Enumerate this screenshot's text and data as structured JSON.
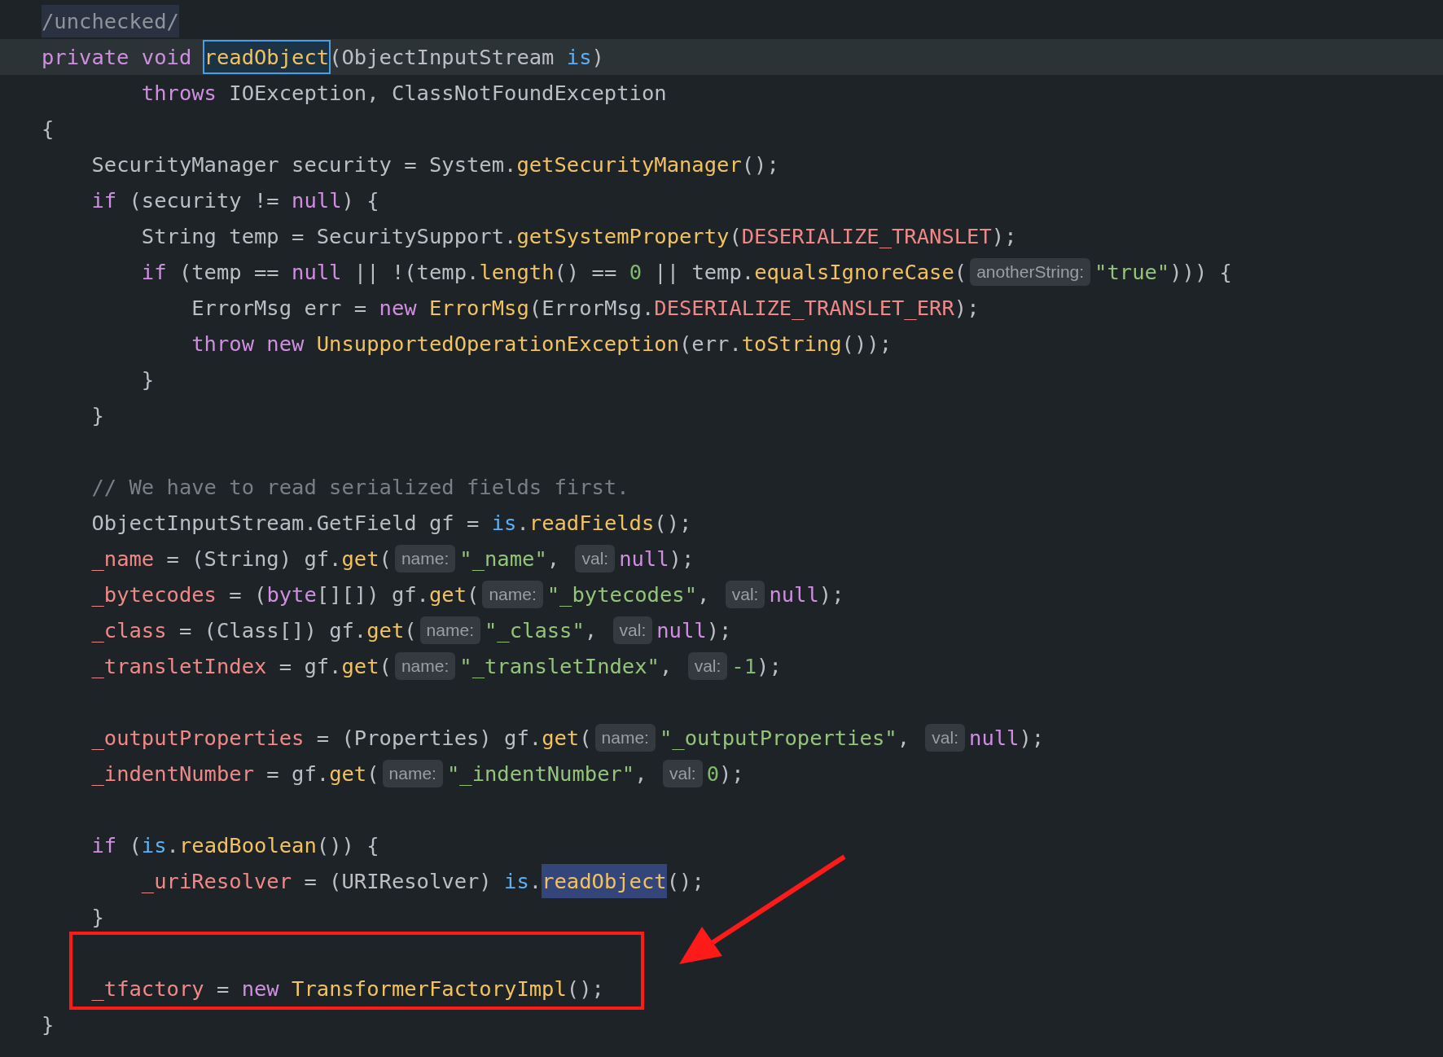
{
  "editor": {
    "lines": [
      {
        "current": false,
        "boxed": false,
        "tokens": [
          {
            "text": "/unchecked/",
            "kind": "folded"
          }
        ]
      },
      {
        "current": true,
        "boxed": false,
        "tokens": [
          {
            "text": "private void ",
            "kind": "keyword"
          },
          {
            "text": "readObject",
            "kind": "method-outlined"
          },
          {
            "text": "(ObjectInputStream ",
            "kind": "plain"
          },
          {
            "text": "is",
            "kind": "param"
          },
          {
            "text": ")",
            "kind": "plain"
          }
        ]
      },
      {
        "current": false,
        "boxed": false,
        "tokens": [
          {
            "text": "        throws ",
            "kind": "keyword"
          },
          {
            "text": "IOException, ClassNotFoundException",
            "kind": "plain"
          }
        ]
      },
      {
        "current": false,
        "boxed": false,
        "tokens": [
          {
            "text": "{",
            "kind": "plain"
          }
        ]
      },
      {
        "current": false,
        "boxed": false,
        "tokens": [
          {
            "text": "    SecurityManager security = System.",
            "kind": "plain"
          },
          {
            "text": "getSecurityManager",
            "kind": "method"
          },
          {
            "text": "();",
            "kind": "plain"
          }
        ]
      },
      {
        "current": false,
        "boxed": false,
        "tokens": [
          {
            "text": "    if ",
            "kind": "keyword"
          },
          {
            "text": "(security != ",
            "kind": "plain"
          },
          {
            "text": "null",
            "kind": "keyword"
          },
          {
            "text": ") {",
            "kind": "plain"
          }
        ]
      },
      {
        "current": false,
        "boxed": false,
        "tokens": [
          {
            "text": "        String temp = SecuritySupport.",
            "kind": "plain"
          },
          {
            "text": "getSystemProperty",
            "kind": "method"
          },
          {
            "text": "(",
            "kind": "plain"
          },
          {
            "text": "DESERIALIZE_TRANSLET",
            "kind": "field"
          },
          {
            "text": ");",
            "kind": "plain"
          }
        ]
      },
      {
        "current": false,
        "boxed": false,
        "tokens": [
          {
            "text": "        if ",
            "kind": "keyword"
          },
          {
            "text": "(temp == ",
            "kind": "plain"
          },
          {
            "text": "null",
            "kind": "keyword"
          },
          {
            "text": " || !(temp.",
            "kind": "plain"
          },
          {
            "text": "length",
            "kind": "method"
          },
          {
            "text": "() == ",
            "kind": "plain"
          },
          {
            "text": "0",
            "kind": "number"
          },
          {
            "text": " || temp.",
            "kind": "plain"
          },
          {
            "text": "equalsIgnoreCase",
            "kind": "method"
          },
          {
            "text": "(",
            "kind": "plain"
          },
          {
            "text": "anotherString:",
            "kind": "hint"
          },
          {
            "text": "\"true\"",
            "kind": "string"
          },
          {
            "text": "))) {",
            "kind": "plain"
          }
        ]
      },
      {
        "current": false,
        "boxed": false,
        "tokens": [
          {
            "text": "            ErrorMsg err = ",
            "kind": "plain"
          },
          {
            "text": "new ",
            "kind": "keyword"
          },
          {
            "text": "ErrorMsg",
            "kind": "method"
          },
          {
            "text": "(ErrorMsg.",
            "kind": "plain"
          },
          {
            "text": "DESERIALIZE_TRANSLET_ERR",
            "kind": "field"
          },
          {
            "text": ");",
            "kind": "plain"
          }
        ]
      },
      {
        "current": false,
        "boxed": false,
        "tokens": [
          {
            "text": "            throw new ",
            "kind": "keyword"
          },
          {
            "text": "UnsupportedOperationException",
            "kind": "method"
          },
          {
            "text": "(err.",
            "kind": "plain"
          },
          {
            "text": "toString",
            "kind": "method"
          },
          {
            "text": "());",
            "kind": "plain"
          }
        ]
      },
      {
        "current": false,
        "boxed": false,
        "tokens": [
          {
            "text": "        }",
            "kind": "plain"
          }
        ]
      },
      {
        "current": false,
        "boxed": false,
        "tokens": [
          {
            "text": "    }",
            "kind": "plain"
          }
        ]
      },
      {
        "current": false,
        "boxed": false
      },
      {
        "current": false,
        "boxed": false,
        "tokens": [
          {
            "text": "    // We have to read serialized fields first.",
            "kind": "comment"
          }
        ]
      },
      {
        "current": false,
        "boxed": false,
        "tokens": [
          {
            "text": "    ObjectInputStream.GetField gf = ",
            "kind": "plain"
          },
          {
            "text": "is",
            "kind": "param"
          },
          {
            "text": ".",
            "kind": "plain"
          },
          {
            "text": "readFields",
            "kind": "method"
          },
          {
            "text": "();",
            "kind": "plain"
          }
        ]
      },
      {
        "current": false,
        "boxed": false,
        "tokens": [
          {
            "text": "    _name",
            "kind": "field"
          },
          {
            "text": " = (String) gf.",
            "kind": "plain"
          },
          {
            "text": "get",
            "kind": "method"
          },
          {
            "text": "(",
            "kind": "plain"
          },
          {
            "text": "name:",
            "kind": "hint"
          },
          {
            "text": "\"_name\"",
            "kind": "string"
          },
          {
            "text": ", ",
            "kind": "plain"
          },
          {
            "text": "val:",
            "kind": "hint"
          },
          {
            "text": "null",
            "kind": "keyword"
          },
          {
            "text": ");",
            "kind": "plain"
          }
        ]
      },
      {
        "current": false,
        "boxed": false,
        "tokens": [
          {
            "text": "    _bytecodes",
            "kind": "field"
          },
          {
            "text": " = (",
            "kind": "plain"
          },
          {
            "text": "byte",
            "kind": "keyword"
          },
          {
            "text": "[][]) gf.",
            "kind": "plain"
          },
          {
            "text": "get",
            "kind": "method"
          },
          {
            "text": "(",
            "kind": "plain"
          },
          {
            "text": "name:",
            "kind": "hint"
          },
          {
            "text": "\"_bytecodes\"",
            "kind": "string"
          },
          {
            "text": ", ",
            "kind": "plain"
          },
          {
            "text": "val:",
            "kind": "hint"
          },
          {
            "text": "null",
            "kind": "keyword"
          },
          {
            "text": ");",
            "kind": "plain"
          }
        ]
      },
      {
        "current": false,
        "boxed": false,
        "tokens": [
          {
            "text": "    _class",
            "kind": "field"
          },
          {
            "text": " = (Class[]) gf.",
            "kind": "plain"
          },
          {
            "text": "get",
            "kind": "method"
          },
          {
            "text": "(",
            "kind": "plain"
          },
          {
            "text": "name:",
            "kind": "hint"
          },
          {
            "text": "\"_class\"",
            "kind": "string"
          },
          {
            "text": ", ",
            "kind": "plain"
          },
          {
            "text": "val:",
            "kind": "hint"
          },
          {
            "text": "null",
            "kind": "keyword"
          },
          {
            "text": ");",
            "kind": "plain"
          }
        ]
      },
      {
        "current": false,
        "boxed": false,
        "tokens": [
          {
            "text": "    _transletIndex",
            "kind": "field"
          },
          {
            "text": " = gf.",
            "kind": "plain"
          },
          {
            "text": "get",
            "kind": "method"
          },
          {
            "text": "(",
            "kind": "plain"
          },
          {
            "text": "name:",
            "kind": "hint"
          },
          {
            "text": "\"_transletIndex\"",
            "kind": "string"
          },
          {
            "text": ", ",
            "kind": "plain"
          },
          {
            "text": "val:",
            "kind": "hint"
          },
          {
            "text": "-1",
            "kind": "number"
          },
          {
            "text": ");",
            "kind": "plain"
          }
        ]
      },
      {
        "current": false,
        "boxed": false
      },
      {
        "current": false,
        "boxed": false,
        "tokens": [
          {
            "text": "    _outputProperties",
            "kind": "field"
          },
          {
            "text": " = (Properties) gf.",
            "kind": "plain"
          },
          {
            "text": "get",
            "kind": "method"
          },
          {
            "text": "(",
            "kind": "plain"
          },
          {
            "text": "name:",
            "kind": "hint"
          },
          {
            "text": "\"_outputProperties\"",
            "kind": "string"
          },
          {
            "text": ", ",
            "kind": "plain"
          },
          {
            "text": "val:",
            "kind": "hint"
          },
          {
            "text": "null",
            "kind": "keyword"
          },
          {
            "text": ");",
            "kind": "plain"
          }
        ]
      },
      {
        "current": false,
        "boxed": false,
        "tokens": [
          {
            "text": "    _indentNumber",
            "kind": "field"
          },
          {
            "text": " = gf.",
            "kind": "plain"
          },
          {
            "text": "get",
            "kind": "method"
          },
          {
            "text": "(",
            "kind": "plain"
          },
          {
            "text": "name:",
            "kind": "hint"
          },
          {
            "text": "\"_indentNumber\"",
            "kind": "string"
          },
          {
            "text": ", ",
            "kind": "plain"
          },
          {
            "text": "val:",
            "kind": "hint"
          },
          {
            "text": "0",
            "kind": "number"
          },
          {
            "text": ");",
            "kind": "plain"
          }
        ]
      },
      {
        "current": false,
        "boxed": false
      },
      {
        "current": false,
        "boxed": false,
        "tokens": [
          {
            "text": "    if ",
            "kind": "keyword"
          },
          {
            "text": "(",
            "kind": "plain"
          },
          {
            "text": "is",
            "kind": "param"
          },
          {
            "text": ".",
            "kind": "plain"
          },
          {
            "text": "readBoolean",
            "kind": "method"
          },
          {
            "text": "()) {",
            "kind": "plain"
          }
        ]
      },
      {
        "current": false,
        "boxed": false,
        "tokens": [
          {
            "text": "        _uriResolver",
            "kind": "field"
          },
          {
            "text": " = (URIResolver) ",
            "kind": "plain"
          },
          {
            "text": "is",
            "kind": "param"
          },
          {
            "text": ".",
            "kind": "plain"
          },
          {
            "text": "readObject",
            "kind": "method-filled"
          },
          {
            "text": "();",
            "kind": "plain"
          }
        ]
      },
      {
        "current": false,
        "boxed": false,
        "tokens": [
          {
            "text": "    }",
            "kind": "plain"
          }
        ]
      },
      {
        "current": false,
        "boxed": true
      },
      {
        "current": false,
        "boxed": true,
        "tokens": [
          {
            "text": "    _tfactory",
            "kind": "field"
          },
          {
            "text": " = ",
            "kind": "plain"
          },
          {
            "text": "new ",
            "kind": "keyword"
          },
          {
            "text": "TransformerFactoryImpl",
            "kind": "method"
          },
          {
            "text": "();",
            "kind": "plain"
          }
        ]
      },
      {
        "current": false,
        "boxed": false,
        "tokens": [
          {
            "text": "}",
            "kind": "plain"
          }
        ]
      }
    ]
  }
}
